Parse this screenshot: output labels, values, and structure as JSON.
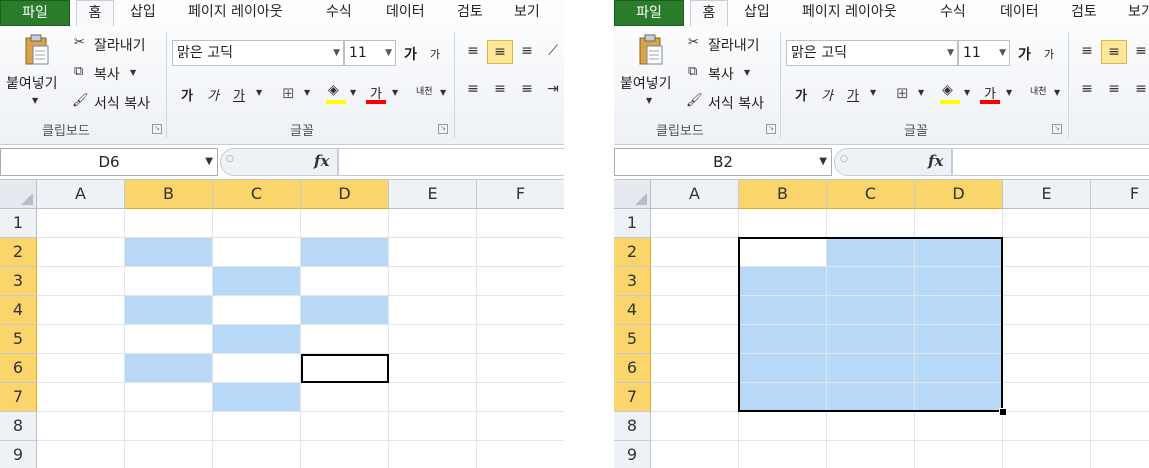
{
  "tabs": [
    "파일",
    "홈",
    "삽입",
    "페이지 레이아웃",
    "수식",
    "데이터",
    "검토",
    "보기"
  ],
  "clipboard": {
    "paste": "붙여넣기",
    "cut": "잘라내기",
    "copy": "복사",
    "format_painter": "서식 복사",
    "label": "클립보드"
  },
  "font": {
    "name": "맑은 고딕",
    "size": "11",
    "grow": "가",
    "shrink": "가",
    "bold": "가",
    "italic": "가",
    "underline": "가",
    "font_color_glyph": "가",
    "phonetic": "내천",
    "label": "글꼴"
  },
  "colors": {
    "highlight": "#b8d8f8",
    "selected_header": "#f9d56b",
    "file_tab": "#2a7b2a",
    "fill_swatch": "#ffff00",
    "font_swatch": "#ff0000"
  },
  "columns": [
    "A",
    "B",
    "C",
    "D",
    "E",
    "F"
  ],
  "rows": [
    "1",
    "2",
    "3",
    "4",
    "5",
    "6",
    "7",
    "8",
    "9"
  ],
  "left": {
    "name_box": "D6",
    "selected_columns": [
      "B",
      "C",
      "D"
    ],
    "selected_rows": [
      "2",
      "3",
      "4",
      "5",
      "6",
      "7"
    ],
    "highlighted_cells": [
      "B2",
      "D2",
      "C3",
      "B4",
      "D4",
      "C5",
      "B6",
      "C7"
    ],
    "active_cell": "D6"
  },
  "right": {
    "name_box": "B2",
    "selected_columns": [
      "B",
      "C",
      "D"
    ],
    "selected_rows": [
      "2",
      "3",
      "4",
      "5",
      "6",
      "7"
    ],
    "selection_range": "B2:D7",
    "active_cell": "B2"
  }
}
